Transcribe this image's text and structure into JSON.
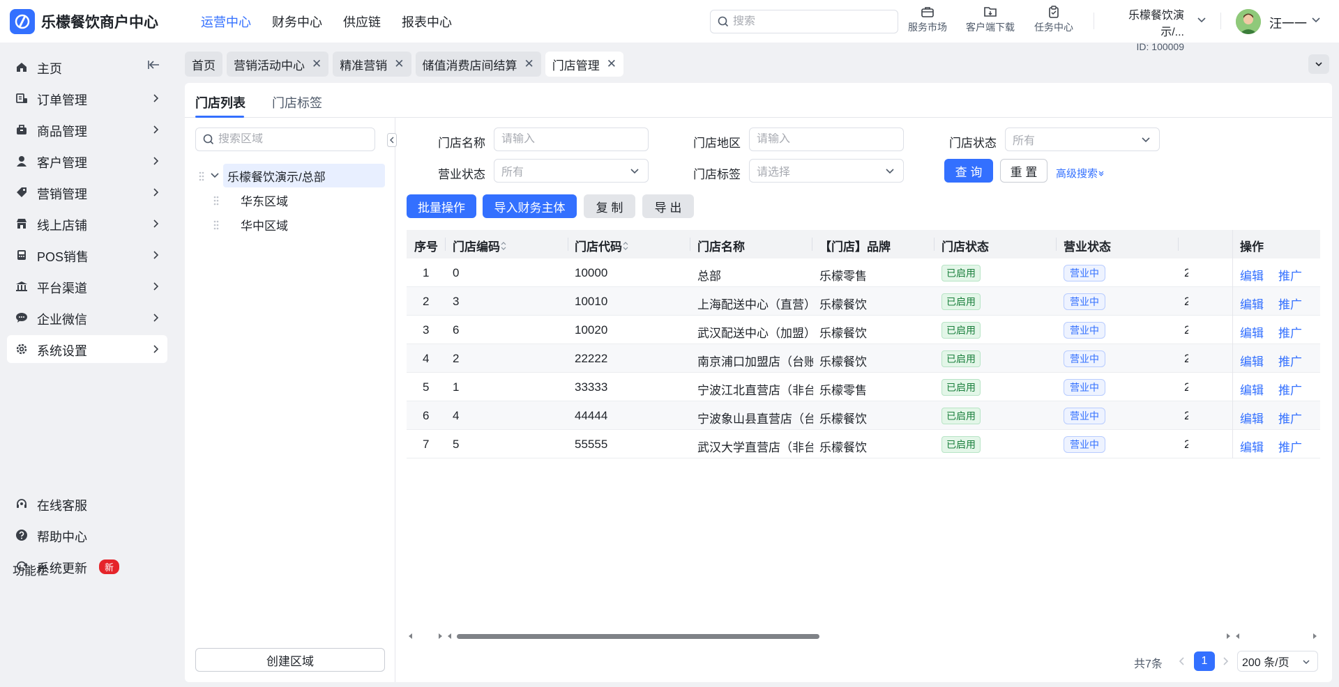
{
  "app": {
    "title": "乐檬餐饮商户中心",
    "brand_color": "#3370ff"
  },
  "topnav": [
    {
      "label": "运营中心",
      "active": true
    },
    {
      "label": "财务中心",
      "active": false
    },
    {
      "label": "供应链",
      "active": false
    },
    {
      "label": "报表中心",
      "active": false
    }
  ],
  "header": {
    "search_placeholder": "搜索",
    "tools": [
      {
        "label": "服务市场",
        "icon": "store-bag-icon"
      },
      {
        "label": "客户端下载",
        "icon": "download-folder-icon"
      },
      {
        "label": "任务中心",
        "icon": "task-clipboard-icon"
      }
    ],
    "merchant_name": "乐檬餐饮演示/...",
    "merchant_id": "ID: 100009",
    "user_name": "汪一一"
  },
  "sidebar": {
    "items": [
      {
        "label": "主页",
        "icon": "home-icon",
        "chevron": false
      },
      {
        "label": "订单管理",
        "icon": "order-icon",
        "chevron": true
      },
      {
        "label": "商品管理",
        "icon": "goods-icon",
        "chevron": true
      },
      {
        "label": "客户管理",
        "icon": "customer-icon",
        "chevron": true
      },
      {
        "label": "营销管理",
        "icon": "tag-icon",
        "chevron": true
      },
      {
        "label": "线上店铺",
        "icon": "shop-icon",
        "chevron": true
      },
      {
        "label": "POS销售",
        "icon": "pos-icon",
        "chevron": true
      },
      {
        "label": "平台渠道",
        "icon": "bank-icon",
        "chevron": true
      },
      {
        "label": "企业微信",
        "icon": "wechat-icon",
        "chevron": true
      },
      {
        "label": "系统设置",
        "icon": "gear-icon",
        "chevron": true,
        "active": true
      }
    ],
    "func_title": "功能栏",
    "func_items": [
      {
        "label": "在线客服",
        "icon": "headset-icon"
      },
      {
        "label": "帮助中心",
        "icon": "help-icon"
      },
      {
        "label": "系统更新",
        "icon": "refresh-icon",
        "badge": "新"
      }
    ]
  },
  "tabs": [
    {
      "label": "首页",
      "closable": false,
      "active": false
    },
    {
      "label": "营销活动中心",
      "closable": true,
      "active": false
    },
    {
      "label": "精准营销",
      "closable": true,
      "active": false
    },
    {
      "label": "储值消费店间结算",
      "closable": true,
      "active": false
    },
    {
      "label": "门店管理",
      "closable": true,
      "active": true
    }
  ],
  "subtabs": [
    {
      "label": "门店列表",
      "active": true
    },
    {
      "label": "门店标签",
      "active": false
    }
  ],
  "tree": {
    "search_placeholder": "搜索区域",
    "root": "乐檬餐饮演示/总部",
    "children": [
      "华东区域",
      "华中区域"
    ],
    "create_label": "创建区域"
  },
  "filters": {
    "store_name": {
      "label": "门店名称",
      "placeholder": "请输入"
    },
    "store_region": {
      "label": "门店地区",
      "placeholder": "请输入"
    },
    "store_status": {
      "label": "门店状态",
      "value": "所有"
    },
    "business_status": {
      "label": "营业状态",
      "value": "所有"
    },
    "store_tag": {
      "label": "门店标签",
      "placeholder": "请选择"
    },
    "query_label": "查 询",
    "reset_label": "重 置",
    "advanced_label": "高级搜索"
  },
  "actions": {
    "batch": "批量操作",
    "import_finance": "导入财务主体",
    "copy": "复 制",
    "export": "导 出"
  },
  "table": {
    "columns": [
      "序号",
      "门店编码",
      "门店代码",
      "门店名称",
      "【门店】品牌",
      "门店状态",
      "营业状态",
      "操作"
    ],
    "rows": [
      {
        "idx": "1",
        "code": "0",
        "dcode": "10000",
        "name": "总部",
        "brand": "乐檬零售",
        "status": "已启用",
        "biz": "营业中"
      },
      {
        "idx": "2",
        "code": "3",
        "dcode": "10010",
        "name": "上海配送中心（直营）",
        "brand": "乐檬餐饮",
        "status": "已启用",
        "biz": "营业中"
      },
      {
        "idx": "3",
        "code": "6",
        "dcode": "10020",
        "name": "武汉配送中心（加盟）",
        "brand": "乐檬餐饮",
        "status": "已启用",
        "biz": "营业中"
      },
      {
        "idx": "4",
        "code": "2",
        "dcode": "22222",
        "name": "南京浦口加盟店（台账）",
        "brand": "乐檬餐饮",
        "status": "已启用",
        "biz": "营业中"
      },
      {
        "idx": "5",
        "code": "1",
        "dcode": "33333",
        "name": "宁波江北直营店（非台账）",
        "brand": "乐檬零售",
        "status": "已启用",
        "biz": "营业中"
      },
      {
        "idx": "6",
        "code": "4",
        "dcode": "44444",
        "name": "宁波象山县直营店（台账）",
        "brand": "乐檬餐饮",
        "status": "已启用",
        "biz": "营业中"
      },
      {
        "idx": "7",
        "code": "5",
        "dcode": "55555",
        "name": "武汉大学直营店（非台账）",
        "brand": "乐檬餐饮",
        "status": "已启用",
        "biz": "营业中"
      }
    ],
    "edit_label": "编辑",
    "promote_label": "推广"
  },
  "pagination": {
    "total": "共7条",
    "current": "1",
    "page_size": "200 条/页"
  }
}
